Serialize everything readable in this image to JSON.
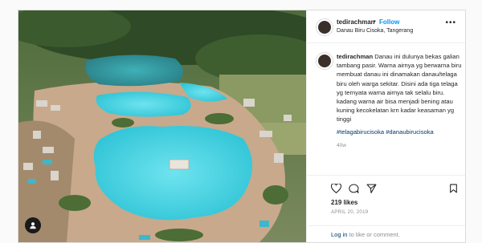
{
  "post": {
    "username": "tedirachman",
    "separator": "•",
    "follow_label": "Follow",
    "location": "Danau Biru Cisoka, Tangerang",
    "more_label": "•••",
    "caption_username": "tedirachman",
    "caption": "Danau ini dulunya bekas galian tambang pasir. Warna airnya yg berwarna biru membuat danau ini dinamakan danau/telaga biru oleh warga sekitar. Disini ada tiga telaga yg ternyata warna airnya tak selalu biru. kadang warna air bisa menjadi bening atau kuning kecokelatan krn kadar keasaman yg tinggi",
    "hashtags": "#telagabirucisoka #danaubirucisoka",
    "time_ago": "40w",
    "likes": "219 likes",
    "date": "APRIL 20, 2019",
    "login_link": "Log in",
    "login_rest": " to like or comment."
  },
  "icons": {
    "heart": "heart-icon",
    "comment": "comment-icon",
    "share": "paper-plane-icon",
    "save": "bookmark-icon",
    "tag": "user-tag-icon"
  },
  "colors": {
    "link": "#0095f6",
    "hashtag": "#00376b",
    "muted": "#8e8e8e",
    "text": "#262626",
    "water": "#48d1e0"
  }
}
